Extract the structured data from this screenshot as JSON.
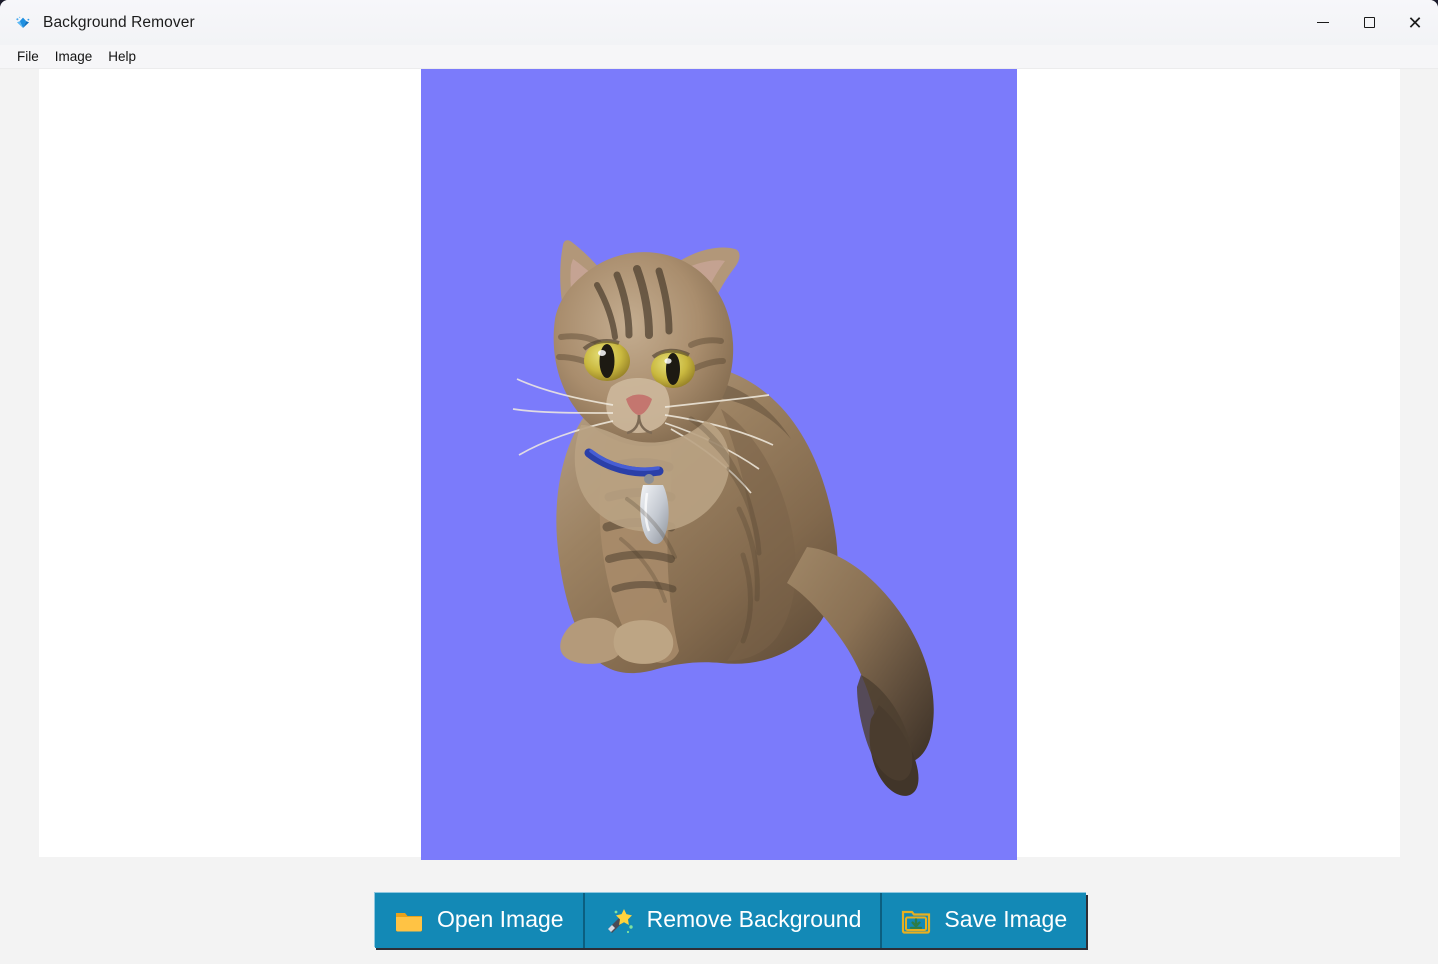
{
  "window": {
    "title": "Background Remover",
    "app_icon": "gem-icon",
    "controls": [
      {
        "name": "minimize",
        "glyph": "—"
      },
      {
        "name": "maximize",
        "glyph": "□"
      },
      {
        "name": "close",
        "glyph": "✕"
      }
    ]
  },
  "menubar": {
    "items": [
      {
        "label": "File"
      },
      {
        "label": "Image"
      },
      {
        "label": "Help"
      }
    ]
  },
  "canvas": {
    "background_color": "#ffffff",
    "image": {
      "subject": "tabby cat sitting with long tail, wearing blue collar with silver tag",
      "background_color": "#7b7bfb",
      "description": "Image preview with solid purple replacement background"
    }
  },
  "toolbar": {
    "accent_color": "#1389b6",
    "buttons": [
      {
        "label": "Open Image",
        "icon": "folder-icon"
      },
      {
        "label": "Remove Background",
        "icon": "magic-wand-icon"
      },
      {
        "label": "Save Image",
        "icon": "save-folder-icon"
      }
    ]
  }
}
